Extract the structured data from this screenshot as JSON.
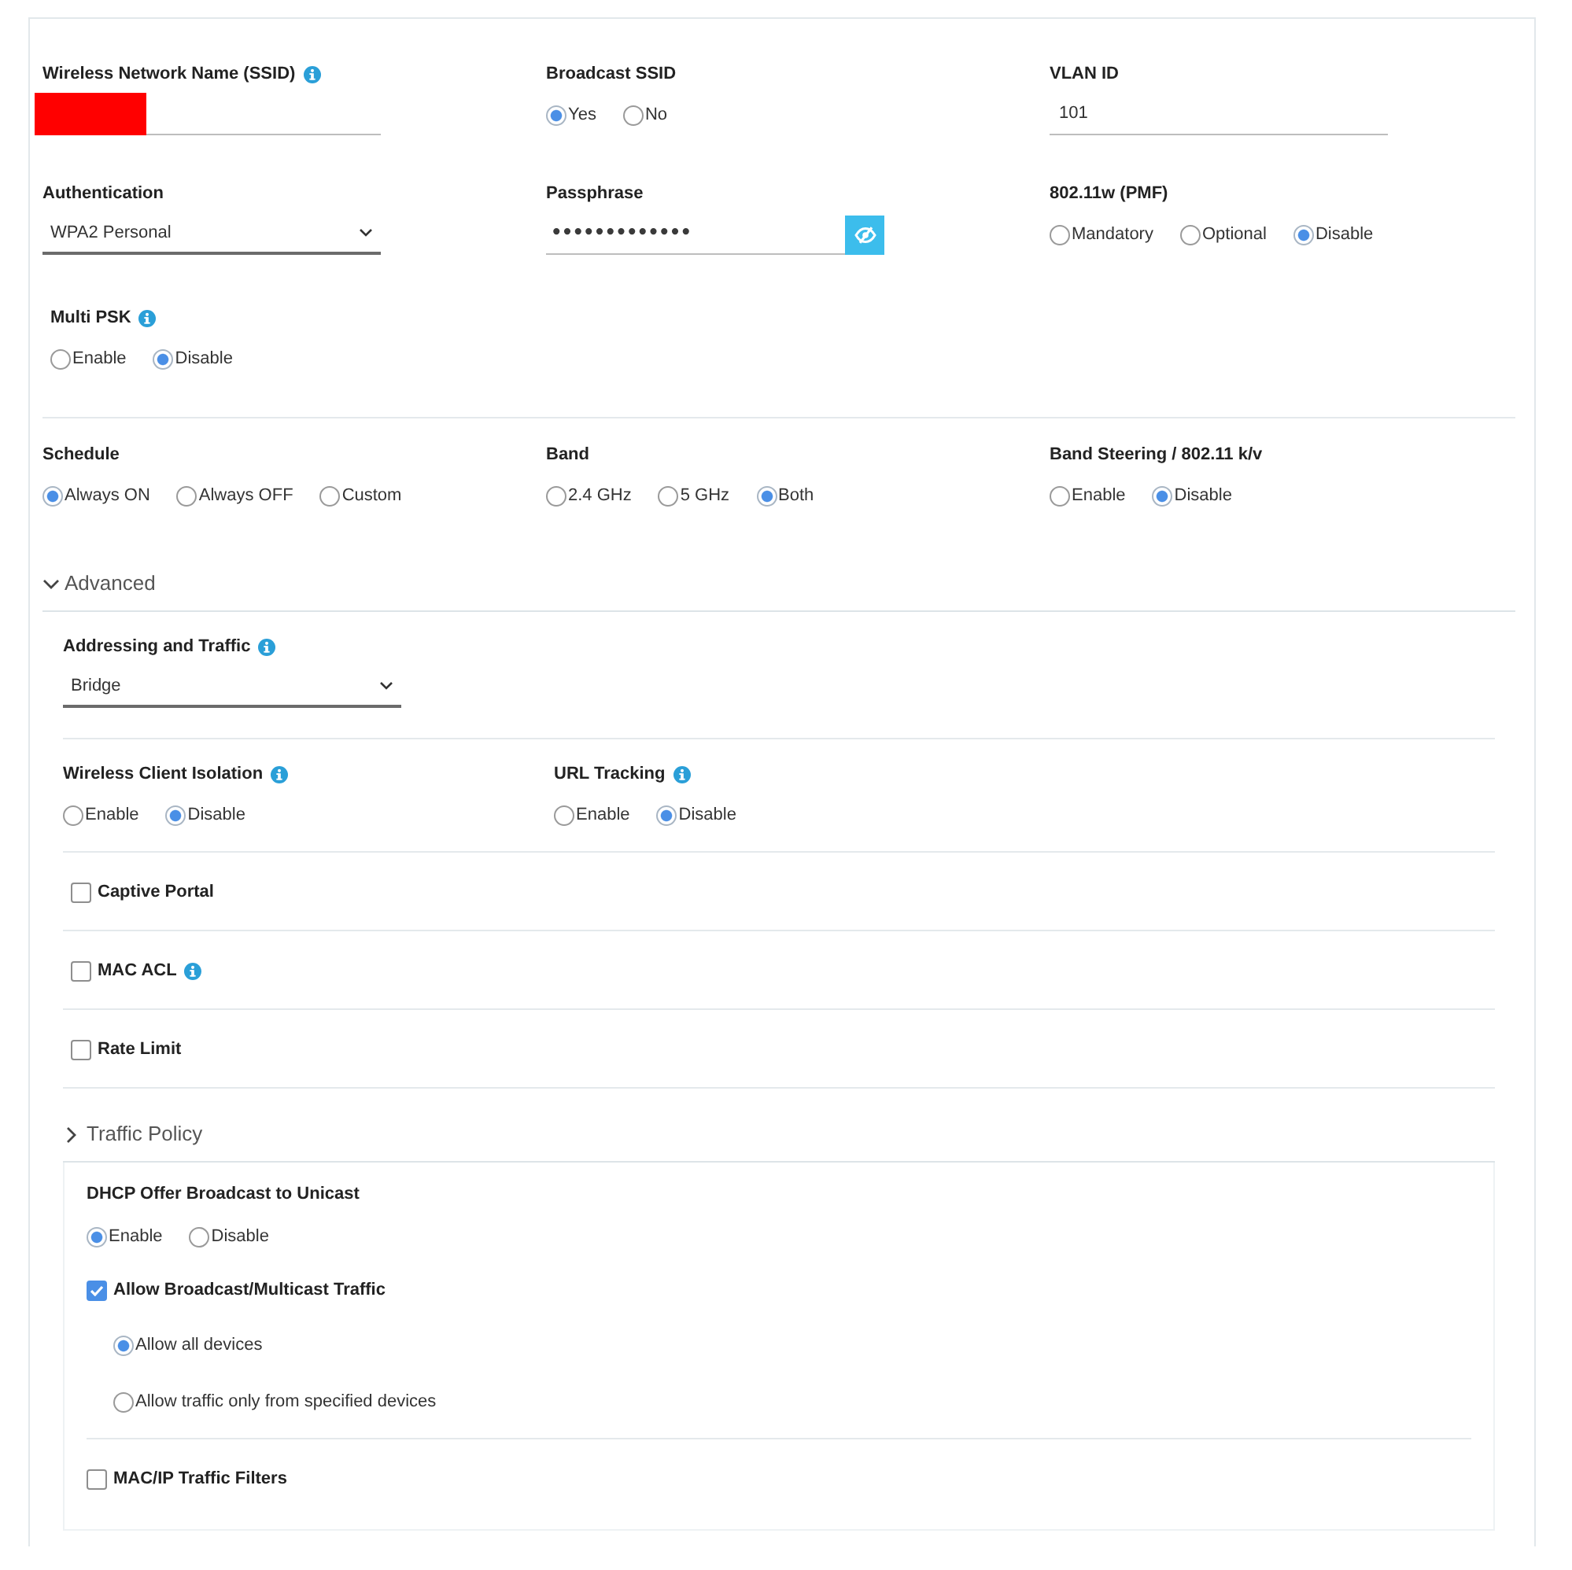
{
  "general": {
    "rows": [
      [
        {
          "kind": "text",
          "label": "Wireless Network Name (SSID)",
          "info": true,
          "redacted": true
        },
        {
          "kind": "radio",
          "label": "Broadcast SSID",
          "options": [
            {
              "label": "Yes",
              "selected": true
            },
            {
              "label": "No",
              "selected": false
            }
          ]
        },
        {
          "kind": "text",
          "label": "VLAN ID",
          "value": "101"
        }
      ],
      [
        {
          "kind": "select",
          "label": "Authentication",
          "value": "WPA2 Personal"
        },
        {
          "kind": "password",
          "label": "Passphrase",
          "value": "•••••••••••••"
        },
        {
          "kind": "radio",
          "label": "802.11w (PMF)",
          "options": [
            {
              "label": "Mandatory",
              "selected": false
            },
            {
              "label": "Optional",
              "selected": false
            },
            {
              "label": "Disable",
              "selected": true
            }
          ]
        }
      ],
      [
        {
          "kind": "radio",
          "label": "Multi PSK",
          "info": true,
          "options": [
            {
              "label": "Enable",
              "selected": false
            },
            {
              "label": "Disable",
              "selected": true
            }
          ]
        }
      ]
    ]
  },
  "radio_settings": [
    {
      "kind": "radio",
      "label": "Schedule",
      "options": [
        {
          "label": "Always ON",
          "selected": true
        },
        {
          "label": "Always OFF",
          "selected": false
        },
        {
          "label": "Custom",
          "selected": false
        }
      ]
    },
    {
      "kind": "radio",
      "label": "Band",
      "options": [
        {
          "label": "2.4 GHz",
          "selected": false
        },
        {
          "label": "5 GHz",
          "selected": false
        },
        {
          "label": "Both",
          "selected": true
        }
      ]
    },
    {
      "kind": "radio",
      "label": "Band Steering / 802.11 k/v",
      "options": [
        {
          "label": "Enable",
          "selected": false
        },
        {
          "label": "Disable",
          "selected": true
        }
      ]
    }
  ],
  "advanced": {
    "title": "Advanced",
    "expanded": true,
    "addressing": {
      "kind": "select",
      "label": "Addressing and Traffic",
      "info": true,
      "value": "Bridge"
    },
    "row": [
      {
        "kind": "radio",
        "label": "Wireless Client Isolation",
        "info": true,
        "options": [
          {
            "label": "Enable",
            "selected": false
          },
          {
            "label": "Disable",
            "selected": true
          }
        ]
      },
      {
        "kind": "radio",
        "label": "URL Tracking",
        "info": true,
        "options": [
          {
            "label": "Enable",
            "selected": false
          },
          {
            "label": "Disable",
            "selected": true
          }
        ]
      }
    ],
    "toggles": [
      {
        "label": "Captive Portal",
        "checked": false
      },
      {
        "label": "MAC ACL",
        "checked": false,
        "info": true
      },
      {
        "label": "Rate Limit",
        "checked": false
      }
    ],
    "traffic_policy": {
      "title": "Traffic Policy",
      "expanded": false
    },
    "traffic": {
      "dhcp": {
        "kind": "radio",
        "label": "DHCP Offer Broadcast to Unicast",
        "options": [
          {
            "label": "Enable",
            "selected": true
          },
          {
            "label": "Disable",
            "selected": false
          }
        ]
      },
      "broadcast": {
        "label": "Allow Broadcast/Multicast Traffic",
        "checked": true,
        "options": [
          {
            "label": "Allow all devices",
            "selected": true
          },
          {
            "label": "Allow traffic only from specified devices",
            "selected": false
          }
        ]
      },
      "filters": {
        "label": "MAC/IP Traffic Filters",
        "checked": false
      }
    }
  }
}
